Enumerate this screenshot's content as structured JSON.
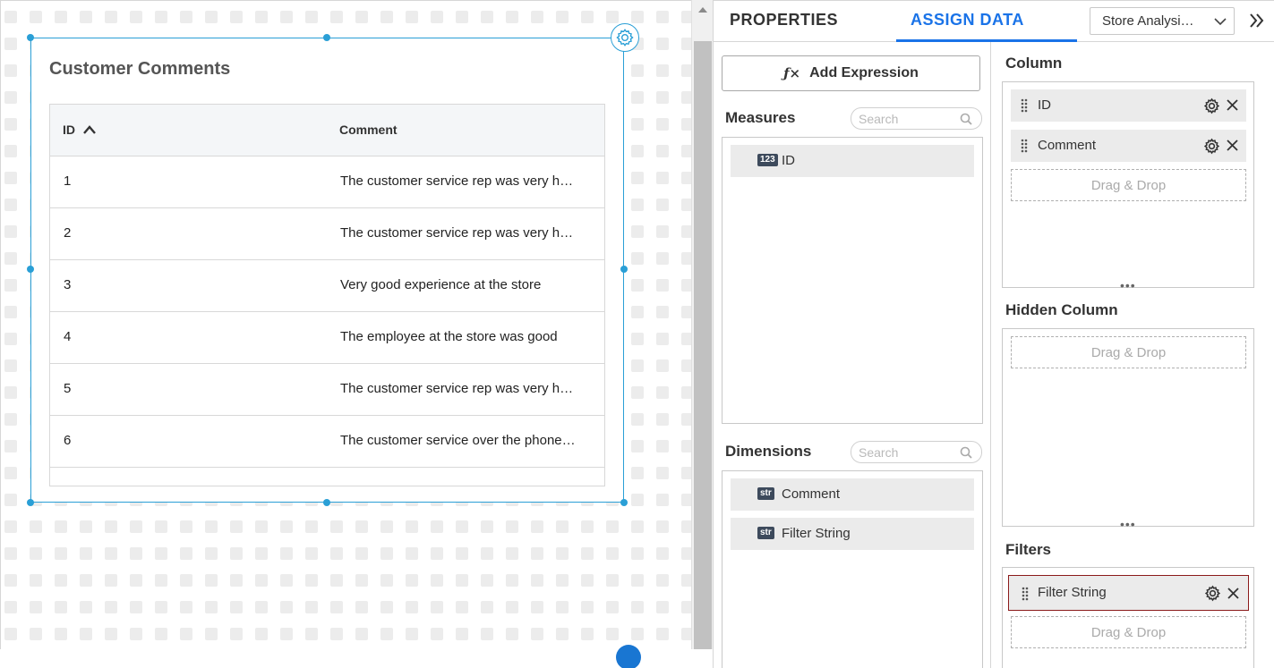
{
  "widget": {
    "title": "Customer Comments",
    "grid": {
      "columns": [
        "ID",
        "Comment"
      ],
      "sort_column": "ID",
      "sort_direction": "ascending",
      "rows": [
        {
          "id": "1",
          "comment": "The customer service rep was very h…"
        },
        {
          "id": "2",
          "comment": "The customer service rep was very h…"
        },
        {
          "id": "3",
          "comment": "Very good experience at the store"
        },
        {
          "id": "4",
          "comment": "The employee at the store was good"
        },
        {
          "id": "5",
          "comment": "The customer service rep was very h…"
        },
        {
          "id": "6",
          "comment": "The customer service over the phone…"
        }
      ]
    }
  },
  "panel": {
    "tabs": {
      "properties": "PROPERTIES",
      "assign_data": "ASSIGN DATA",
      "active": "ASSIGN DATA"
    },
    "datasource_select": "Store Analysi…",
    "add_expression": "Add Expression",
    "measures": {
      "title": "Measures",
      "search_placeholder": "Search",
      "items": [
        {
          "type": "123",
          "name": "ID"
        }
      ]
    },
    "dimensions": {
      "title": "Dimensions",
      "search_placeholder": "Search",
      "items": [
        {
          "type": "str",
          "name": "Comment"
        },
        {
          "type": "str",
          "name": "Filter String"
        }
      ]
    },
    "column": {
      "title": "Column",
      "items": [
        "ID",
        "Comment"
      ],
      "drop_label": "Drag & Drop"
    },
    "hidden_column": {
      "title": "Hidden Column",
      "drop_label": "Drag & Drop"
    },
    "filters": {
      "title": "Filters",
      "items": [
        "Filter String"
      ],
      "drop_label": "Drag & Drop"
    }
  },
  "colors": {
    "accent": "#1a73e8",
    "selection": "#2a9fd6",
    "filter_border": "#8b1a1a"
  }
}
